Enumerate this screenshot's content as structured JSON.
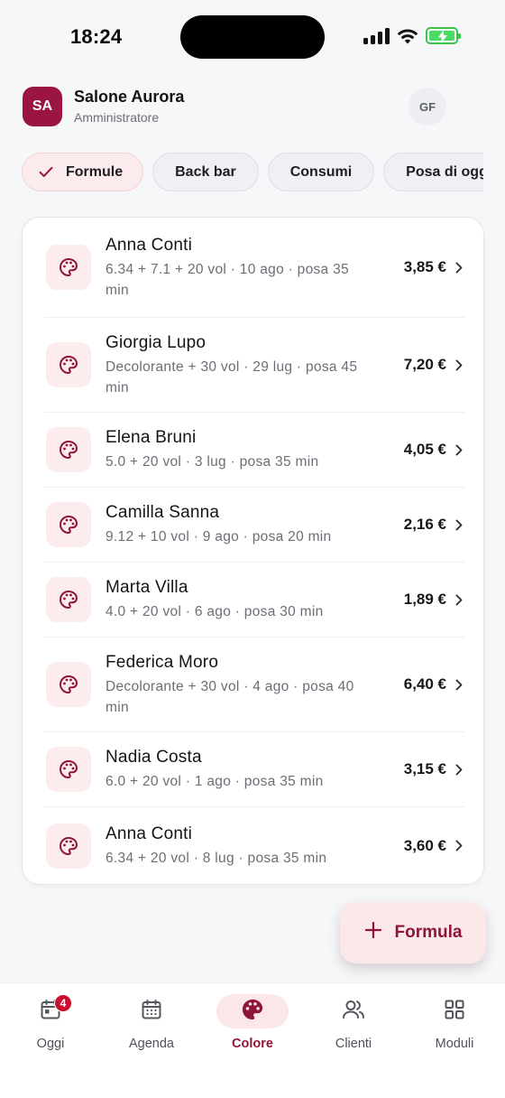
{
  "status": {
    "time": "18:24"
  },
  "header": {
    "logo_initials": "SA",
    "salon_name": "Salone Aurora",
    "role": "Amministratore",
    "user_initials": "GF"
  },
  "chips": [
    {
      "label": "Formule",
      "active": true
    },
    {
      "label": "Back bar",
      "active": false
    },
    {
      "label": "Consumi",
      "active": false
    },
    {
      "label": "Posa di oggi",
      "active": false
    }
  ],
  "formulas": [
    {
      "name": "Anna Conti",
      "detail": "6.34 + 7.1 + 20 vol · 10 ago · posa 35 min",
      "price": "3,85 €"
    },
    {
      "name": "Giorgia Lupo",
      "detail": "Decolorante + 30 vol · 29 lug · posa 45 min",
      "price": "7,20 €"
    },
    {
      "name": "Elena Bruni",
      "detail": "5.0 + 20 vol · 3 lug · posa 35 min",
      "price": "4,05 €"
    },
    {
      "name": "Camilla Sanna",
      "detail": "9.12 + 10 vol · 9 ago · posa 20 min",
      "price": "2,16 €"
    },
    {
      "name": "Marta Villa",
      "detail": "4.0 + 20 vol · 6 ago · posa 30 min",
      "price": "1,89 €"
    },
    {
      "name": "Federica Moro",
      "detail": "Decolorante + 30 vol · 4 ago · posa 40 min",
      "price": "6,40 €"
    },
    {
      "name": "Nadia Costa",
      "detail": "6.0 + 20 vol · 1 ago · posa 35 min",
      "price": "3,15 €"
    },
    {
      "name": "Anna Conti",
      "detail": "6.34 + 20 vol · 8 lug · posa 35 min",
      "price": "3,60 €"
    }
  ],
  "fab": {
    "label": "Formula",
    "icon": "plus-icon"
  },
  "nav": [
    {
      "label": "Oggi",
      "icon": "today-icon",
      "badge": "4",
      "active": false
    },
    {
      "label": "Agenda",
      "icon": "calendar-icon",
      "active": false
    },
    {
      "label": "Colore",
      "icon": "palette-icon",
      "active": true
    },
    {
      "label": "Clienti",
      "icon": "users-icon",
      "active": false
    },
    {
      "label": "Moduli",
      "icon": "grid-icon",
      "active": false
    }
  ],
  "colors": {
    "brand": "#9a1640",
    "accent": "#8e1538",
    "accent_bg": "#fbe6e8",
    "badge": "#c8102e"
  }
}
